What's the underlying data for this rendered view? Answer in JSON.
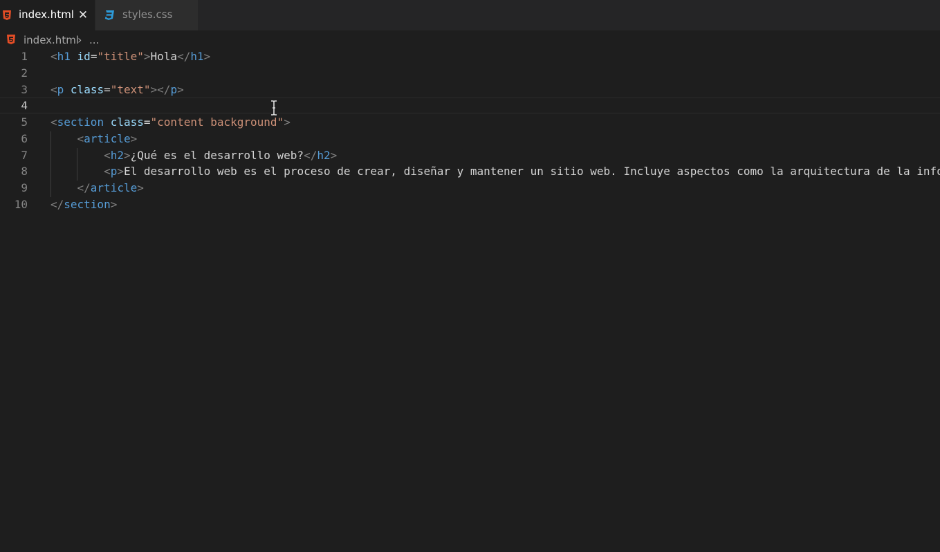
{
  "tabs": [
    {
      "label": "index.html",
      "icon": "html5-icon",
      "active": true,
      "close": "✕"
    },
    {
      "label": "styles.css",
      "icon": "css3-icon",
      "active": false
    }
  ],
  "breadcrumb": {
    "file": "index.html",
    "separator": "›",
    "more": "..."
  },
  "editor": {
    "current_line": 4,
    "lines": [
      {
        "n": "1",
        "tokens": [
          [
            "br",
            "<"
          ],
          [
            "tg",
            "h1"
          ],
          [
            "tx",
            " "
          ],
          [
            "at",
            "id"
          ],
          [
            "tx",
            "="
          ],
          [
            "st",
            "\"title\""
          ],
          [
            "br",
            ">"
          ],
          [
            "tx",
            "Hola"
          ],
          [
            "br",
            "</"
          ],
          [
            "tg",
            "h1"
          ],
          [
            "br",
            ">"
          ]
        ]
      },
      {
        "n": "2",
        "tokens": []
      },
      {
        "n": "3",
        "tokens": [
          [
            "br",
            "<"
          ],
          [
            "tg",
            "p"
          ],
          [
            "tx",
            " "
          ],
          [
            "at",
            "class"
          ],
          [
            "tx",
            "="
          ],
          [
            "st",
            "\"text\""
          ],
          [
            "br",
            "></"
          ],
          [
            "tg",
            "p"
          ],
          [
            "br",
            ">"
          ]
        ]
      },
      {
        "n": "4",
        "tokens": []
      },
      {
        "n": "5",
        "tokens": [
          [
            "br",
            "<"
          ],
          [
            "tg",
            "section"
          ],
          [
            "tx",
            " "
          ],
          [
            "at",
            "class"
          ],
          [
            "tx",
            "="
          ],
          [
            "st",
            "\"content background\""
          ],
          [
            "br",
            ">"
          ]
        ]
      },
      {
        "n": "6",
        "tokens": [
          [
            "tx",
            "    "
          ],
          [
            "br",
            "<"
          ],
          [
            "tg",
            "article"
          ],
          [
            "br",
            ">"
          ]
        ]
      },
      {
        "n": "7",
        "tokens": [
          [
            "tx",
            "        "
          ],
          [
            "br",
            "<"
          ],
          [
            "tg",
            "h2"
          ],
          [
            "br",
            ">"
          ],
          [
            "tx",
            "¿Qué es el desarrollo web?"
          ],
          [
            "br",
            "</"
          ],
          [
            "tg",
            "h2"
          ],
          [
            "br",
            ">"
          ]
        ]
      },
      {
        "n": "8",
        "tokens": [
          [
            "tx",
            "        "
          ],
          [
            "br",
            "<"
          ],
          [
            "tg",
            "p"
          ],
          [
            "br",
            ">"
          ],
          [
            "tx",
            "El desarrollo web es el proceso de crear, diseñar y mantener un sitio web. Incluye aspectos como la arquitectura de la info"
          ]
        ]
      },
      {
        "n": "9",
        "tokens": [
          [
            "tx",
            "    "
          ],
          [
            "br",
            "</"
          ],
          [
            "tg",
            "article"
          ],
          [
            "br",
            ">"
          ]
        ]
      },
      {
        "n": "10",
        "tokens": [
          [
            "br",
            "</"
          ],
          [
            "tg",
            "section"
          ],
          [
            "br",
            ">"
          ]
        ]
      }
    ]
  },
  "colors": {
    "background": "#1e1e1e",
    "tag": "#569cd6",
    "attribute": "#9cdcfe",
    "string": "#ce9178",
    "text": "#d4d4d4",
    "html_icon": "#e44d26",
    "css_icon": "#2d9cdb"
  }
}
